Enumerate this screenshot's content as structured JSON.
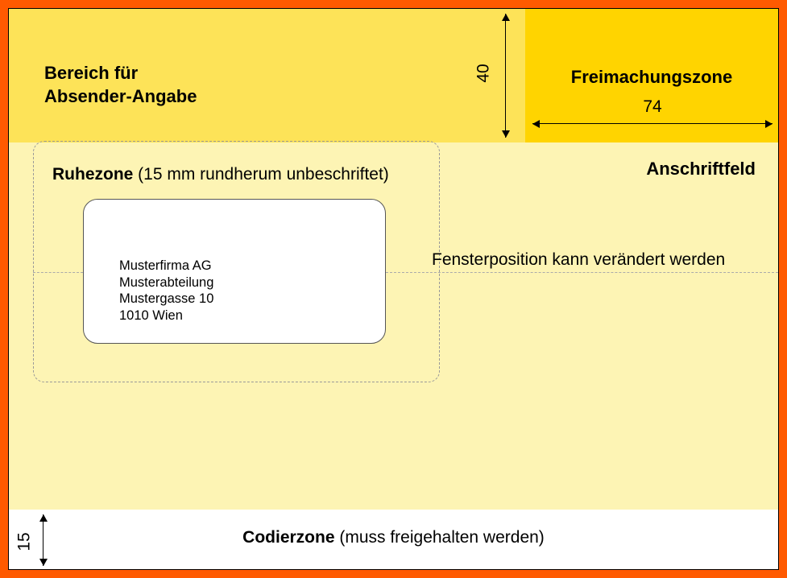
{
  "sender": {
    "label": "Bereich für\nAbsender-Angabe"
  },
  "franking": {
    "label": "Freimachungszone",
    "width_mm": "74"
  },
  "top_height_mm": "40",
  "address_field": {
    "label": "Anschriftfeld"
  },
  "ruhezone": {
    "label_bold": "Ruhezone",
    "label_rest": " (15 mm rundherum unbeschriftet)"
  },
  "window": {
    "note": "Fensterposition kann verändert werden",
    "address": {
      "line1": "Musterfirma AG",
      "line2": "Musterabteilung",
      "line3": "Mustergasse 10",
      "line4": "1010 Wien"
    }
  },
  "codierzone": {
    "label_bold": "Codierzone",
    "label_rest": " (muss freigehalten werden)",
    "height_mm": "15"
  }
}
